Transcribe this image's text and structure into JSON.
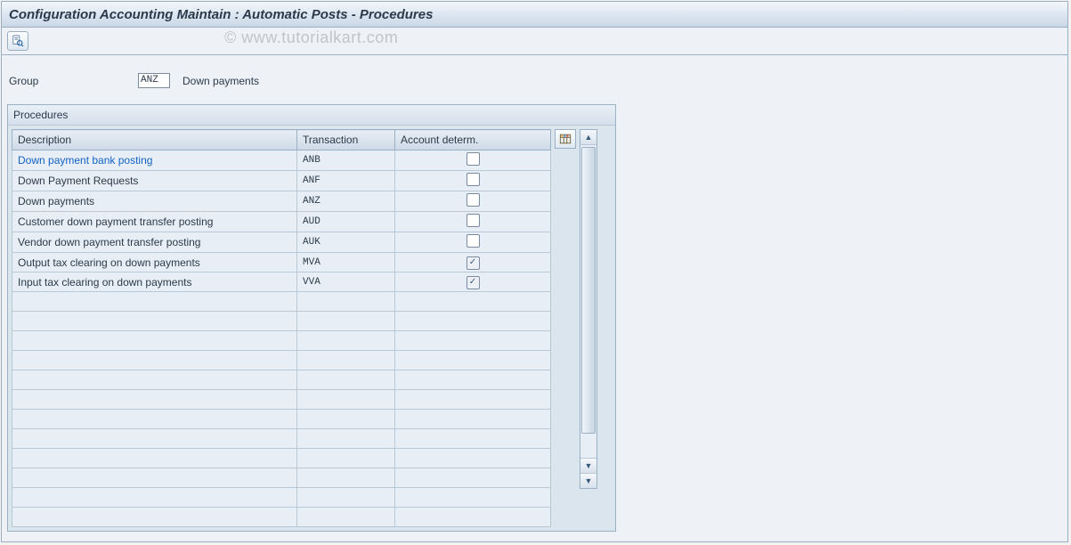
{
  "title": "Configuration Accounting Maintain : Automatic Posts - Procedures",
  "watermark": "© www.tutorialkart.com",
  "header": {
    "group_label": "Group",
    "group_value": "ANZ",
    "group_desc": "Down payments"
  },
  "panel": {
    "title": "Procedures",
    "columns": {
      "desc": "Description",
      "trx": "Transaction",
      "acct": "Account determ."
    },
    "rows": [
      {
        "desc": "Down payment bank posting",
        "trx": "ANB",
        "acct": false,
        "link": true
      },
      {
        "desc": "Down Payment Requests",
        "trx": "ANF",
        "acct": false,
        "link": false
      },
      {
        "desc": "Down payments",
        "trx": "ANZ",
        "acct": false,
        "link": false
      },
      {
        "desc": "Customer down payment transfer posting",
        "trx": "AUD",
        "acct": false,
        "link": false
      },
      {
        "desc": "Vendor down payment transfer posting",
        "trx": "AUK",
        "acct": false,
        "link": false
      },
      {
        "desc": "Output tax clearing on down payments",
        "trx": "MVA",
        "acct": true,
        "link": false
      },
      {
        "desc": "Input tax clearing on down payments",
        "trx": "VVA",
        "acct": true,
        "link": false
      }
    ],
    "empty_rows": 12
  }
}
